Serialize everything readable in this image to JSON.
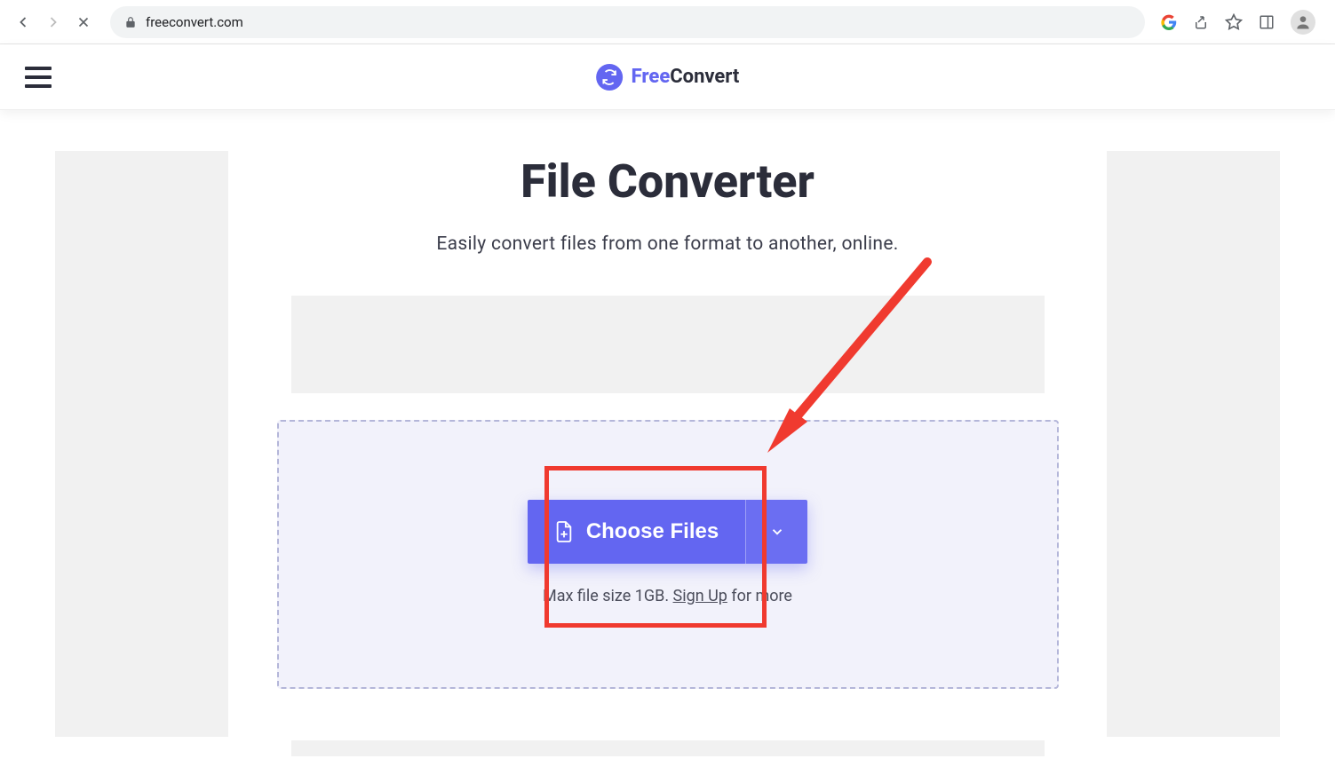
{
  "browser": {
    "url": "freeconvert.com"
  },
  "header": {
    "brand_free": "Free",
    "brand_convert": "Convert"
  },
  "main": {
    "title": "File Converter",
    "subtitle": "Easily convert files from one format to another, online.",
    "choose_label": "Choose Files",
    "limit_prefix": "Max file size 1GB. ",
    "signup": "Sign Up",
    "limit_suffix": " for more"
  },
  "colors": {
    "accent": "#6366f1",
    "text_dark": "#2b2d3a",
    "annotation": "#f03a2f"
  }
}
